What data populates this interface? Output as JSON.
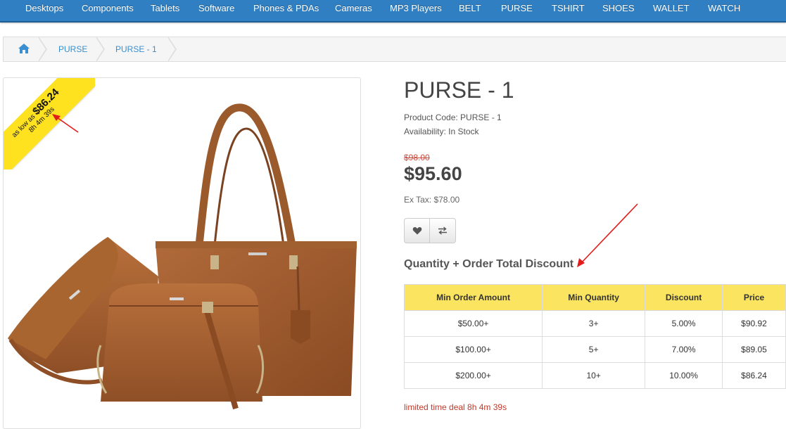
{
  "topnav": {
    "items": [
      "Desktops",
      "Components",
      "Tablets",
      "Software",
      "Phones & PDAs",
      "Cameras",
      "MP3 Players",
      "BELT",
      "PURSE",
      "TSHIRT",
      "SHOES",
      "WALLET",
      "WATCH"
    ]
  },
  "breadcrumb": {
    "home_icon": "home-icon",
    "items": [
      "PURSE",
      "PURSE - 1"
    ]
  },
  "ribbon": {
    "prefix": "as low as",
    "price": "$86.24",
    "timer": "8h 4m 39s"
  },
  "product": {
    "title": "PURSE - 1",
    "code": "Product Code: PURSE - 1",
    "availability": "Availability: In Stock",
    "old_price": "$98.00",
    "price": "$95.60",
    "ex_tax": "Ex Tax: $78.00",
    "wishlist_icon": "heart-icon",
    "compare_icon": "compare-arrows-icon"
  },
  "discount": {
    "heading": "Quantity + Order Total Discount",
    "columns": [
      "Min Order Amount",
      "Min Quantity",
      "Discount",
      "Price"
    ],
    "rows": [
      [
        "$50.00+",
        "3+",
        "5.00%",
        "$90.92"
      ],
      [
        "$100.00+",
        "5+",
        "7.00%",
        "$89.05"
      ],
      [
        "$200.00+",
        "10+",
        "10.00%",
        "$86.24"
      ]
    ],
    "deal_text": "limited time deal 8h 4m 39s"
  },
  "colors": {
    "nav": "#2f7fc2",
    "ribbon": "#ffe21f",
    "table_header": "#fbe45f",
    "old_price": "#cc4a3d",
    "annotation_arrow": "#e21b1b"
  }
}
